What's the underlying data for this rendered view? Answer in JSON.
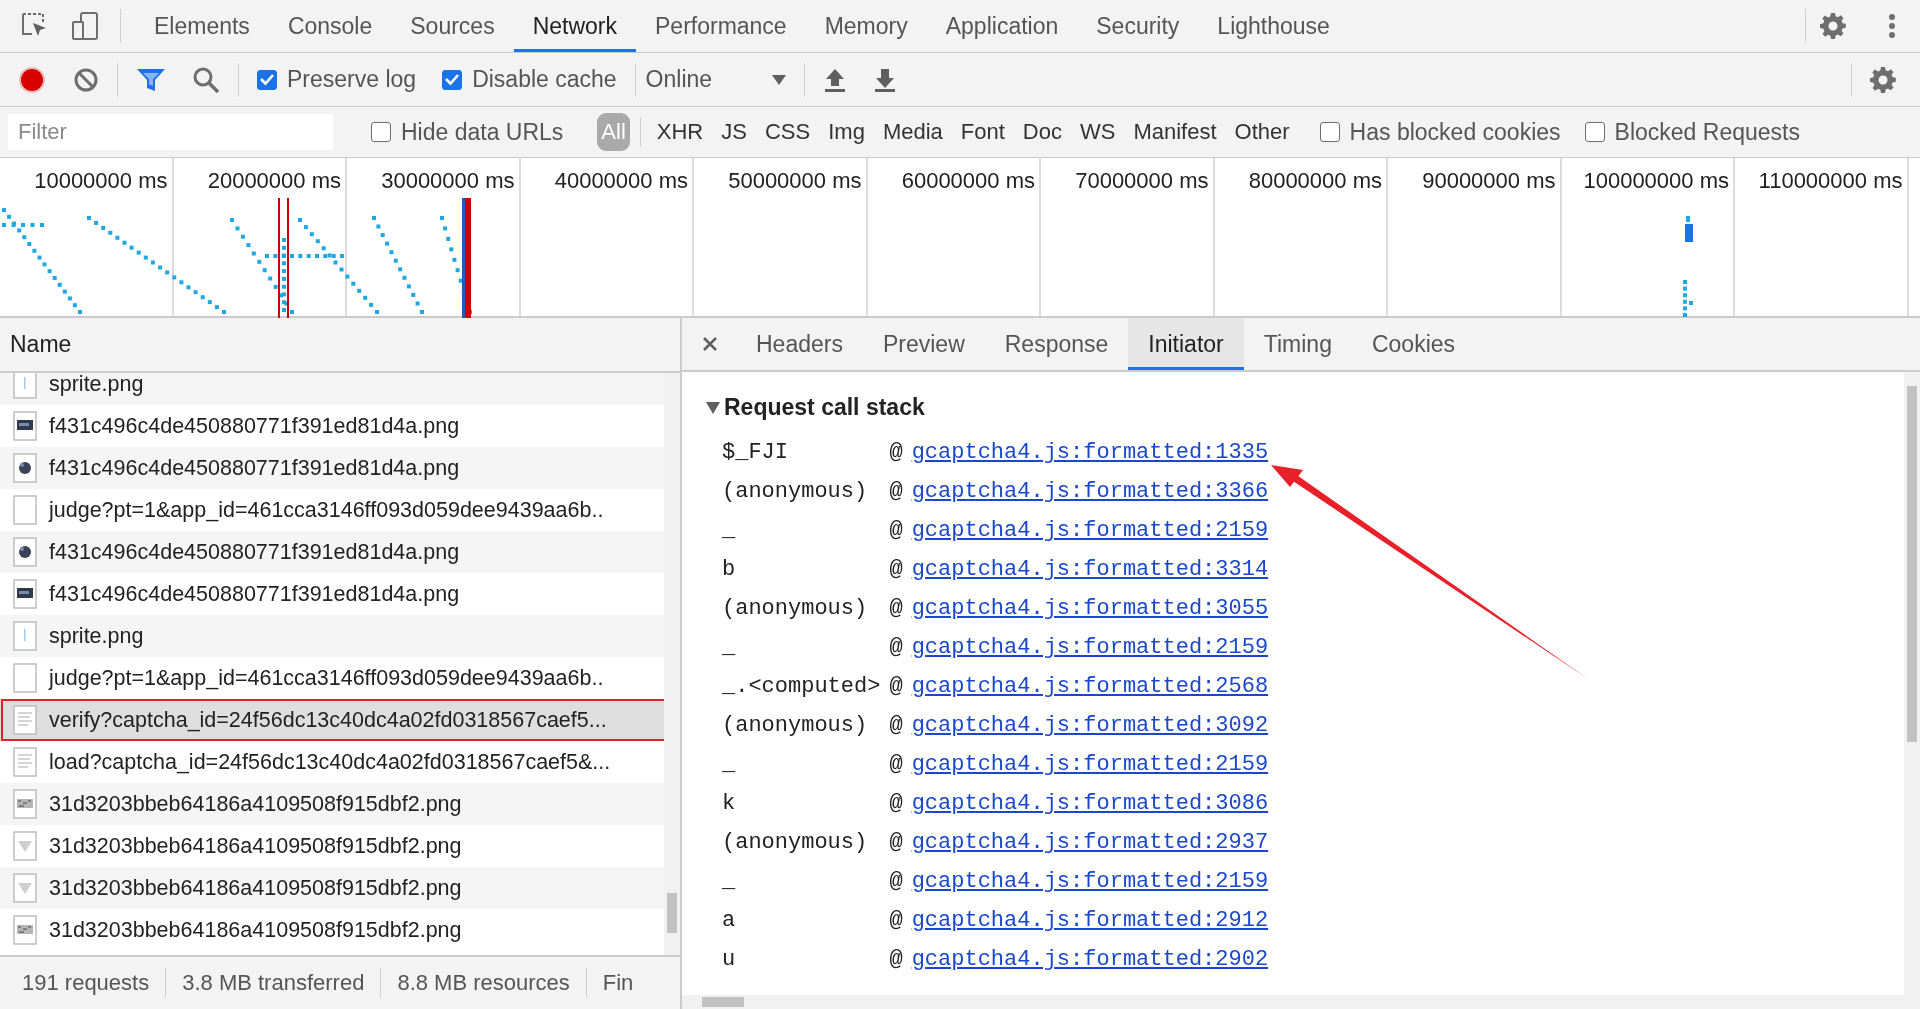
{
  "top_tabs": [
    {
      "label": "Elements",
      "selected": false
    },
    {
      "label": "Console",
      "selected": false
    },
    {
      "label": "Sources",
      "selected": false
    },
    {
      "label": "Network",
      "selected": true
    },
    {
      "label": "Performance",
      "selected": false
    },
    {
      "label": "Memory",
      "selected": false
    },
    {
      "label": "Application",
      "selected": false
    },
    {
      "label": "Security",
      "selected": false
    },
    {
      "label": "Lighthouse",
      "selected": false
    }
  ],
  "toolbar": {
    "recording": true,
    "preserve_log": {
      "label": "Preserve log",
      "checked": true
    },
    "disable_cache": {
      "label": "Disable cache",
      "checked": true
    },
    "throttling": {
      "value": "Online"
    }
  },
  "filter_bar": {
    "placeholder": "Filter",
    "hide_data_urls": {
      "label": "Hide data URLs",
      "checked": false
    },
    "types": [
      {
        "label": "All",
        "selected": true
      },
      {
        "label": "XHR",
        "selected": false
      },
      {
        "label": "JS",
        "selected": false
      },
      {
        "label": "CSS",
        "selected": false
      },
      {
        "label": "Img",
        "selected": false
      },
      {
        "label": "Media",
        "selected": false
      },
      {
        "label": "Font",
        "selected": false
      },
      {
        "label": "Doc",
        "selected": false
      },
      {
        "label": "WS",
        "selected": false
      },
      {
        "label": "Manifest",
        "selected": false
      },
      {
        "label": "Other",
        "selected": false
      }
    ],
    "has_blocked_cookies": {
      "label": "Has blocked cookies",
      "checked": false
    },
    "blocked_requests": {
      "label": "Blocked Requests",
      "checked": false
    }
  },
  "timeline": {
    "ticks": [
      "10000000 ms",
      "20000000 ms",
      "30000000 ms",
      "40000000 ms",
      "50000000 ms",
      "60000000 ms",
      "70000000 ms",
      "80000000 ms",
      "90000000 ms",
      "100000000 ms",
      "110000000 ms"
    ]
  },
  "requests": {
    "column": "Name",
    "rows": [
      {
        "name": "sprite.png",
        "kind": "sprite",
        "selected": false,
        "highlighted": false
      },
      {
        "name": "f431c496c4de450880771f391ed81d4a.png",
        "kind": "dark-image",
        "selected": false,
        "highlighted": false
      },
      {
        "name": "f431c496c4de450880771f391ed81d4a.png",
        "kind": "blob-image",
        "selected": false,
        "highlighted": false
      },
      {
        "name": "judge?pt=1&app_id=461cca3146ff093d059dee9439aa6b..",
        "kind": "blank",
        "selected": false,
        "highlighted": false
      },
      {
        "name": "f431c496c4de450880771f391ed81d4a.png",
        "kind": "blob-image",
        "selected": false,
        "highlighted": false
      },
      {
        "name": "f431c496c4de450880771f391ed81d4a.png",
        "kind": "dark-image",
        "selected": false,
        "highlighted": false
      },
      {
        "name": "sprite.png",
        "kind": "sprite",
        "selected": false,
        "highlighted": false
      },
      {
        "name": "judge?pt=1&app_id=461cca3146ff093d059dee9439aa6b..",
        "kind": "blank",
        "selected": false,
        "highlighted": false
      },
      {
        "name": "verify?captcha_id=24f56dc13c40dc4a02fd0318567caef5...",
        "kind": "document",
        "selected": true,
        "highlighted": true
      },
      {
        "name": "load?captcha_id=24f56dc13c40dc4a02fd0318567caef5&...",
        "kind": "document",
        "selected": false,
        "highlighted": false
      },
      {
        "name": "31d3203bbeb64186a4109508f915dbf2.png",
        "kind": "noise-image",
        "selected": false,
        "highlighted": false
      },
      {
        "name": "31d3203bbeb64186a4109508f915dbf2.png",
        "kind": "triangle-image",
        "selected": false,
        "highlighted": false
      },
      {
        "name": "31d3203bbeb64186a4109508f915dbf2.png",
        "kind": "triangle-image",
        "selected": false,
        "highlighted": false
      },
      {
        "name": "31d3203bbeb64186a4109508f915dbf2.png",
        "kind": "noise-image",
        "selected": false,
        "highlighted": false
      }
    ]
  },
  "status_bar": [
    "191 requests",
    "3.8 MB transferred",
    "8.8 MB resources",
    "Fin"
  ],
  "detail_tabs": [
    {
      "label": "Headers",
      "selected": false
    },
    {
      "label": "Preview",
      "selected": false
    },
    {
      "label": "Response",
      "selected": false
    },
    {
      "label": "Initiator",
      "selected": true
    },
    {
      "label": "Timing",
      "selected": false
    },
    {
      "label": "Cookies",
      "selected": false
    }
  ],
  "call_stack": {
    "title": "Request call stack",
    "expanded": true,
    "frames": [
      {
        "function": "$_FJI",
        "at": "@",
        "location": "gcaptcha4.js:formatted:1335"
      },
      {
        "function": "(anonymous)",
        "at": "@",
        "location": "gcaptcha4.js:formatted:3366"
      },
      {
        "function": "_",
        "at": "@",
        "location": "gcaptcha4.js:formatted:2159"
      },
      {
        "function": "b",
        "at": "@",
        "location": "gcaptcha4.js:formatted:3314"
      },
      {
        "function": "(anonymous)",
        "at": "@",
        "location": "gcaptcha4.js:formatted:3055"
      },
      {
        "function": "_",
        "at": "@",
        "location": "gcaptcha4.js:formatted:2159"
      },
      {
        "function": "_.<computed>",
        "at": "@",
        "location": "gcaptcha4.js:formatted:2568"
      },
      {
        "function": "(anonymous)",
        "at": "@",
        "location": "gcaptcha4.js:formatted:3092"
      },
      {
        "function": "_",
        "at": "@",
        "location": "gcaptcha4.js:formatted:2159"
      },
      {
        "function": "k",
        "at": "@",
        "location": "gcaptcha4.js:formatted:3086"
      },
      {
        "function": "(anonymous)",
        "at": "@",
        "location": "gcaptcha4.js:formatted:2937"
      },
      {
        "function": "_",
        "at": "@",
        "location": "gcaptcha4.js:formatted:2159"
      },
      {
        "function": "a",
        "at": "@",
        "location": "gcaptcha4.js:formatted:2912"
      },
      {
        "function": "u",
        "at": "@",
        "location": "gcaptcha4.js:formatted:2902"
      }
    ]
  }
}
